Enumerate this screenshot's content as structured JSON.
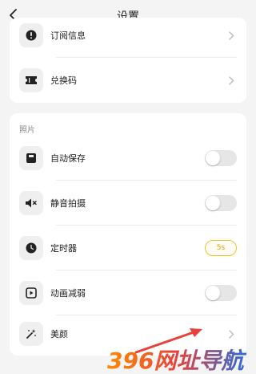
{
  "header": {
    "title": "设置",
    "back_icon": "chevron-left-icon"
  },
  "top_card": {
    "items": [
      {
        "label": "订阅信息",
        "icon": "alert-icon"
      },
      {
        "label": "兑换码",
        "icon": "ticket-icon"
      }
    ]
  },
  "photo_card": {
    "section_title": "照片",
    "items": [
      {
        "label": "自动保存",
        "icon": "save-icon",
        "control": "toggle",
        "enabled": false
      },
      {
        "label": "静音拍摄",
        "icon": "mute-speaker-icon",
        "control": "toggle",
        "enabled": false
      },
      {
        "label": "定时器",
        "icon": "clock-icon",
        "control": "pill",
        "value": "5s"
      },
      {
        "label": "动画减弱",
        "icon": "play-box-icon",
        "control": "toggle",
        "enabled": false
      },
      {
        "label": "美颜",
        "icon": "magic-wand-icon",
        "control": "chevron"
      }
    ]
  },
  "colors": {
    "accent_yellow": "#f2c12e",
    "arrow_red": "#e8403a"
  },
  "watermark": {
    "text": "396网址导航"
  }
}
